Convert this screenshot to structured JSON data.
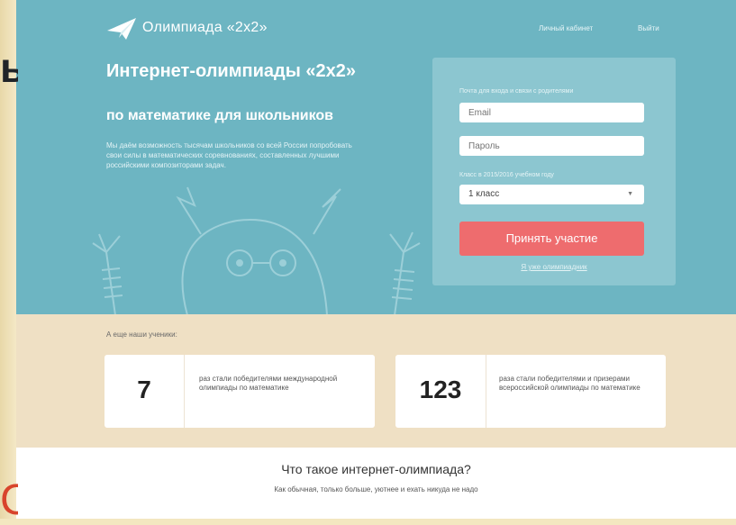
{
  "site": {
    "logo_text": "Олимпиада «2x2»",
    "nav": {
      "cabinet": "Личный кабинет",
      "logout": "Выйти"
    }
  },
  "hero": {
    "title": "Интернет-олимпиады «2x2»",
    "subtitle": "по математике для школьников",
    "description": "Мы даём возможность тысячам школьников со всей России попробовать свои силы в математических соревнованиях, составленных лучшими российскими композиторами задач."
  },
  "form": {
    "note": "Почта для входа и связи с родителями",
    "email_placeholder": "Email",
    "password_placeholder": "Пароль",
    "class_note": "Класс в 2015/2016 учебном году",
    "class_selected": "1 класс",
    "submit_label": "Принять участие",
    "already_link": "Я уже олимпиадник"
  },
  "stats": {
    "caption": "А еще наши ученики:",
    "cards": [
      {
        "number": "7",
        "text": "раз стали победителями международной олимпиады по математике"
      },
      {
        "number": "123",
        "text": "раза стали победителями и призерами всероссийской олимпиады по математике"
      }
    ]
  },
  "about": {
    "title": "Что такое интернет-олимпиада?",
    "subtitle": "Как обычная, только больше, уютнее и ехать никуда не надо"
  },
  "colors": {
    "hero_bg": "#6db5c2",
    "form_panel": "#8cc6d0",
    "button": "#ee6c6e",
    "stats_bg": "#efe0c4",
    "slide_bg": "#f3e7c0"
  },
  "icons": {
    "logo": "paper-plane-icon",
    "select": "chevron-down-icon"
  }
}
